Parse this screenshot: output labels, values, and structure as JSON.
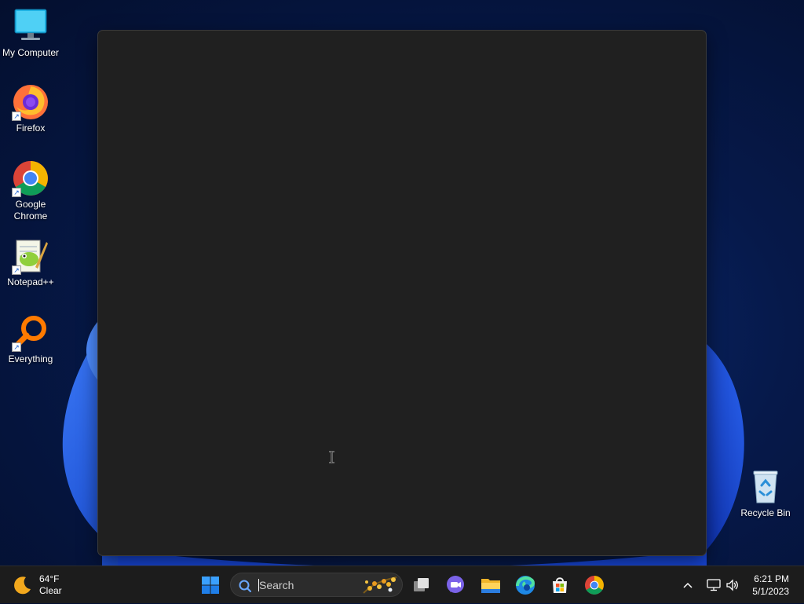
{
  "desktop": {
    "icons": [
      {
        "label": "My Computer",
        "icon": "monitor-icon"
      },
      {
        "label": "Firefox",
        "icon": "firefox-icon"
      },
      {
        "label": "Google Chrome",
        "icon": "chrome-icon"
      },
      {
        "label": "Notepad++",
        "icon": "notepad-plus-plus-icon"
      },
      {
        "label": "Everything",
        "icon": "everything-search-icon"
      },
      {
        "label": "Recycle Bin",
        "icon": "recycle-bin-icon"
      }
    ]
  },
  "weather": {
    "temperature": "64°F",
    "condition": "Clear",
    "icon": "moon-icon"
  },
  "taskbar": {
    "search_placeholder": "Search",
    "pinned": [
      "start-icon",
      "task-view-icon",
      "teams-chat-icon",
      "file-explorer-icon",
      "edge-icon",
      "microsoft-store-icon",
      "chrome-icon"
    ]
  },
  "tray": {
    "time": "6:21 PM",
    "date": "5/1/2023",
    "icons": [
      "chevron-up-icon",
      "network-icon",
      "volume-icon"
    ]
  },
  "colors": {
    "taskbar": "#1c1c1c",
    "panel": "#202020",
    "wallpaper": "#06194a",
    "accent": "#1a6fe8"
  }
}
